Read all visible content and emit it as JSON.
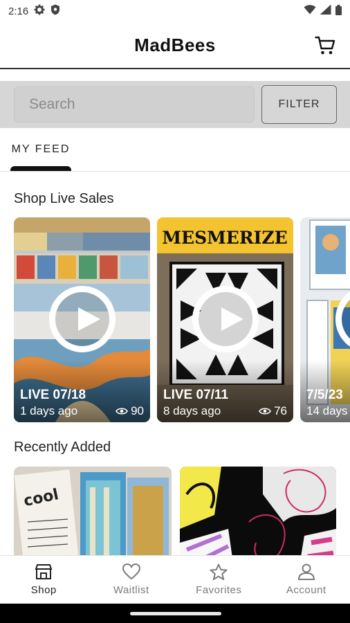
{
  "status_bar": {
    "time": "2:16",
    "left_icons": [
      "gear-icon",
      "shield-icon"
    ],
    "right_icons": [
      "wifi-icon",
      "signal-icon",
      "battery-icon"
    ]
  },
  "header": {
    "title": "MadBees",
    "cart_icon": "cart-icon"
  },
  "search": {
    "placeholder": "Search",
    "value": "",
    "filter_label": "FILTER"
  },
  "tabs": [
    {
      "label": "MY FEED",
      "active": true
    }
  ],
  "live_sales": {
    "title": "Shop Live Sales",
    "cards": [
      {
        "live_label": "LIVE 07/18",
        "ago": "1 days ago",
        "views": "90",
        "theme": "sampler-quilt"
      },
      {
        "live_label": "LIVE 07/11",
        "ago": "8 days ago",
        "views": "76",
        "theme": "mesmerize-quilt",
        "art_text": "MESMERIZE"
      },
      {
        "live_label": "7/5/23",
        "ago": "14 days",
        "views": "",
        "theme": "framed-prints"
      }
    ]
  },
  "recently_added": {
    "title": "Recently Added",
    "items": [
      {
        "theme": "fabric-bundle",
        "art_text": "cool"
      },
      {
        "theme": "black-fabric"
      }
    ]
  },
  "bottom_nav": {
    "items": [
      {
        "label": "Shop",
        "icon": "shop-icon",
        "active": true
      },
      {
        "label": "Waitlist",
        "icon": "heart-icon",
        "active": false
      },
      {
        "label": "Favorites",
        "icon": "star-icon",
        "active": false
      },
      {
        "label": "Account",
        "icon": "account-icon",
        "active": false
      }
    ]
  },
  "colors": {
    "accent": "#111111",
    "search_band": "#d6d6d6",
    "card_yellow": "#f4c430",
    "inactive_nav": "#7a7a7a"
  }
}
